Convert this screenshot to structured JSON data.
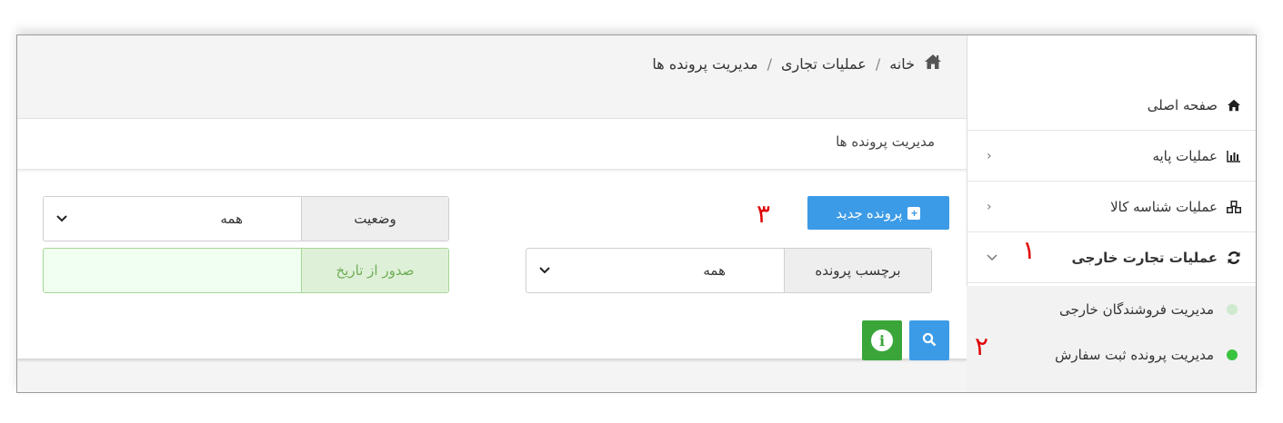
{
  "breadcrumb": {
    "home": "خانه",
    "separator": "/",
    "level2": "عملیات تجاری",
    "level3": "مدیریت پرونده ها"
  },
  "page_title": "مدیریت پرونده ها",
  "sidebar": {
    "items": [
      {
        "label": "صفحه اصلی",
        "icon": "home-icon"
      },
      {
        "label": "عملیات پایه",
        "icon": "bar-chart-icon"
      },
      {
        "label": "عملیات شناسه کالا",
        "icon": "cubes-icon"
      },
      {
        "label": "عملیات تجارت خارجی",
        "icon": "refresh-icon"
      }
    ],
    "subitems": [
      {
        "label": "مدیریت فروشندگان خارجی",
        "dot_color": "#cfe9cf"
      },
      {
        "label": "مدیریت پرونده ثبت سفارش",
        "dot_color": "#39c43f"
      }
    ]
  },
  "toolbar": {
    "new_button": "پرونده جدید"
  },
  "filters": {
    "status_label": "وضعیت",
    "status_value": "همه",
    "tag_label": "برچسب پرونده",
    "tag_value": "همه",
    "date_from_label": "صدور از تاریخ"
  },
  "annotations": [
    "۱",
    "۲",
    "۳"
  ],
  "colors": {
    "primary": "#3c9be7",
    "success": "#3aa63a",
    "annotation": "#e00000",
    "date_addon_bg": "#dff0d8",
    "date_addon_text": "#6fae57"
  }
}
